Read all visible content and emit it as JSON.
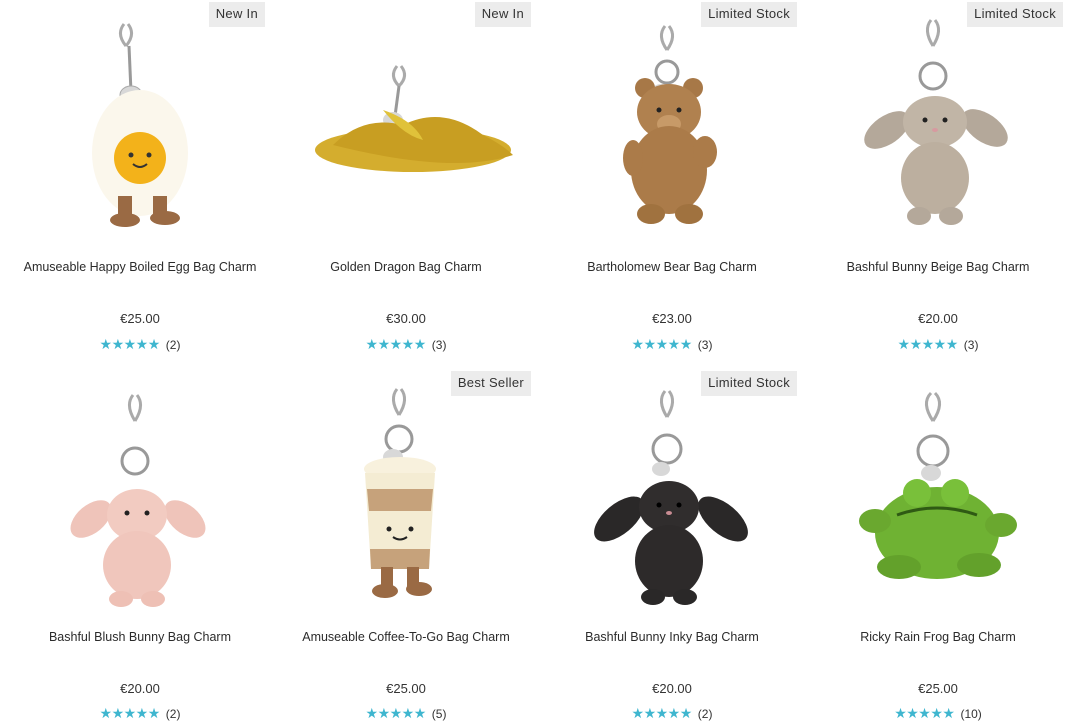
{
  "products": [
    {
      "badge": "New In",
      "name": "Amuseable Happy Boiled Egg Bag Charm",
      "price": "€25.00",
      "stars": "★★★★★",
      "count": "(2)",
      "image_icon": "egg-plush-icon"
    },
    {
      "badge": "New In",
      "name": "Golden Dragon Bag Charm",
      "price": "€30.00",
      "stars": "★★★★★",
      "count": "(3)",
      "image_icon": "dragon-plush-icon"
    },
    {
      "badge": "Limited Stock",
      "name": "Bartholomew Bear Bag Charm",
      "price": "€23.00",
      "stars": "★★★★★",
      "count": "(3)",
      "image_icon": "bear-plush-icon"
    },
    {
      "badge": "Limited Stock",
      "name": "Bashful Bunny Beige Bag Charm",
      "price": "€20.00",
      "stars": "★★★★★",
      "count": "(3)",
      "image_icon": "bunny-beige-plush-icon"
    },
    {
      "badge": "",
      "name": "Bashful Blush Bunny Bag Charm",
      "price": "€20.00",
      "stars": "★★★★★",
      "count": "(2)",
      "image_icon": "bunny-blush-plush-icon"
    },
    {
      "badge": "Best Seller",
      "name": "Amuseable Coffee-To-Go Bag Charm",
      "price": "€25.00",
      "stars": "★★★★★",
      "count": "(5)",
      "image_icon": "coffee-cup-plush-icon"
    },
    {
      "badge": "Limited Stock",
      "name": "Bashful Bunny Inky Bag Charm",
      "price": "€20.00",
      "stars": "★★★★★",
      "count": "(2)",
      "image_icon": "bunny-inky-plush-icon"
    },
    {
      "badge": "",
      "name": "Ricky Rain Frog Bag Charm",
      "price": "€25.00",
      "stars": "★★★★★",
      "count": "(10)",
      "image_icon": "frog-plush-icon"
    }
  ],
  "colors": {
    "star": "#3fb6cf",
    "badge_bg": "#ececec"
  }
}
